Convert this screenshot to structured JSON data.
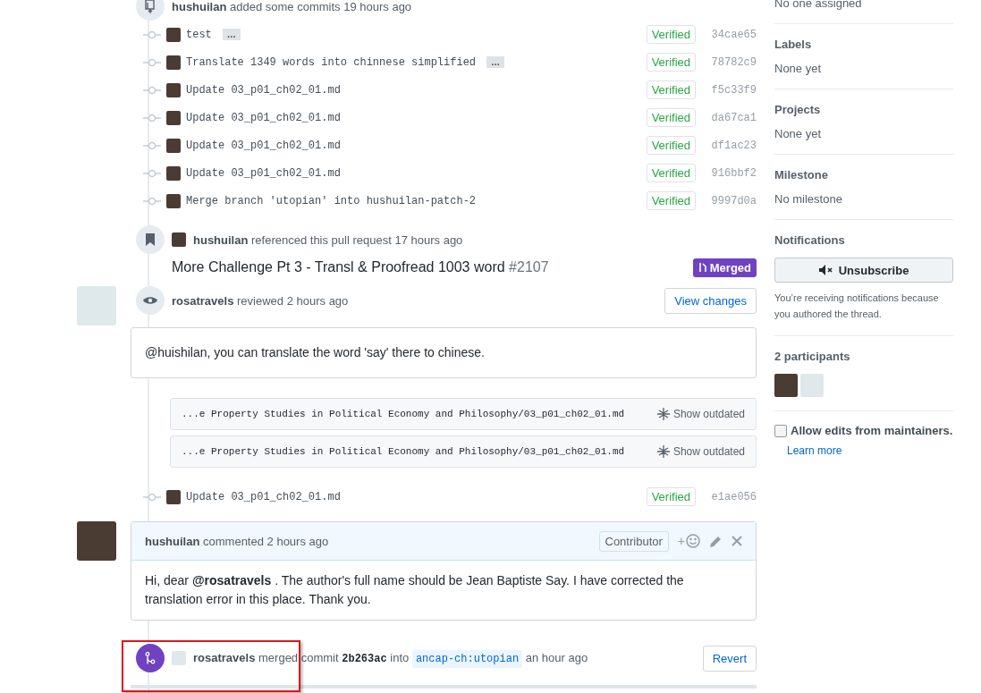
{
  "timeline": [
    {
      "kind": "commits",
      "actor": "hushuilan",
      "action": "added some commits",
      "time": "19 hours ago",
      "commits": [
        {
          "message": "test",
          "more": "…",
          "badge": "Verified",
          "sha": "34cae65"
        },
        {
          "message": "Translate 1349 words into chinnese simplified",
          "more": "…",
          "badge": "Verified",
          "sha": "78782c9"
        },
        {
          "message": "Update 03_p01_ch02_01.md",
          "badge": "Verified",
          "sha": "f5c33f9"
        },
        {
          "message": "Update 03_p01_ch02_01.md",
          "badge": "Verified",
          "sha": "da67ca1"
        },
        {
          "message": "Update 03_p01_ch02_01.md",
          "badge": "Verified",
          "sha": "df1ac23"
        },
        {
          "message": "Update 03_p01_ch02_01.md",
          "badge": "Verified",
          "sha": "916bbf2"
        },
        {
          "message": "Merge branch 'utopian' into hushuilan-patch-2",
          "badge": "Verified",
          "sha": "9997d0a"
        }
      ]
    },
    {
      "kind": "reference",
      "actor": "hushuilan",
      "action": "referenced this pull request",
      "time": "17 hours ago",
      "title": "More Challenge Pt 3 - Transl & Proofread 1003 word",
      "number": "#2107",
      "status": "Merged"
    },
    {
      "kind": "review",
      "actor": "rosatravels",
      "action": "reviewed",
      "time": "2 hours ago",
      "button": "View changes",
      "body": "@huishilan, you can translate the word 'say' there to chinese.",
      "files": [
        {
          "path": "...e Property Studies in Political Economy and Philosophy/03_p01_ch02_01.md",
          "action": "Show outdated"
        },
        {
          "path": "...e Property Studies in Political Economy and Philosophy/03_p01_ch02_01.md",
          "action": "Show outdated"
        }
      ],
      "commits": [
        {
          "message": "Update 03_p01_ch02_01.md",
          "badge": "Verified",
          "sha": "e1ae056"
        }
      ]
    },
    {
      "kind": "comment",
      "actor": "hushuilan",
      "action": "commented",
      "time": "2 hours ago",
      "role": "Contributor",
      "reaction": "+",
      "body": "Hi, dear **@rosatravels** . The author's full name should be Jean Baptiste Say. I have corrected the translation error in this place. Thank you."
    },
    {
      "kind": "merge",
      "actor": "rosatravels",
      "action": "merged",
      "object": "commit",
      "sha": "2b263ac",
      "joiner": "into",
      "branch": "ancap-ch:utopian",
      "time": "an hour ago",
      "button": "Revert",
      "highlighted": true
    }
  ],
  "sidebar": {
    "sections": [
      {
        "value": "No one assigned"
      },
      {
        "title": "Labels",
        "value": "None yet"
      },
      {
        "title": "Projects",
        "value": "None yet"
      },
      {
        "title": "Milestone",
        "value": "No milestone"
      }
    ],
    "notifications": {
      "title": "Notifications",
      "button": "Unsubscribe",
      "note": "You’re receiving notifications because you authored the thread."
    },
    "participants": {
      "title": "2 participants",
      "people": [
        {
          "color": "#4a3b33"
        },
        {
          "color": "#dfe9ec"
        }
      ]
    },
    "maintainer_edits": {
      "label": "Allow edits from maintainers.",
      "checked": false,
      "link": "Learn more"
    }
  }
}
